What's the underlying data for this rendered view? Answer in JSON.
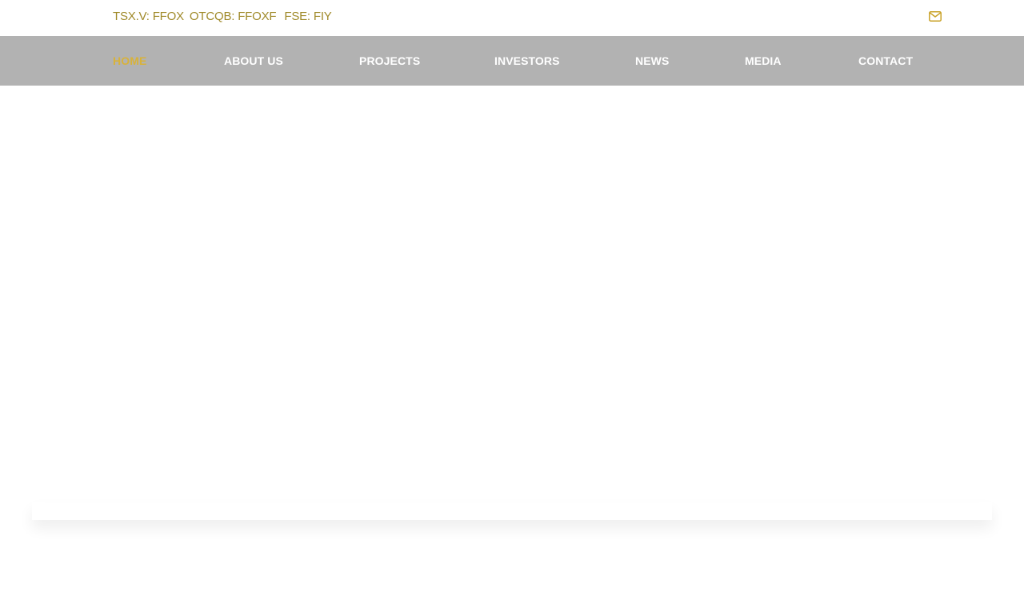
{
  "topbar": {
    "tickers": [
      "TSX.V: FFOX",
      "OTCQB: FFOXF",
      "FSE: FIY"
    ],
    "mail_icon": "envelope-icon",
    "accent_color": "#a08a2a"
  },
  "nav": {
    "items": [
      {
        "label": "HOME",
        "active": true
      },
      {
        "label": "ABOUT US",
        "active": false
      },
      {
        "label": "PROJECTS",
        "active": false
      },
      {
        "label": "INVESTORS",
        "active": false
      },
      {
        "label": "NEWS",
        "active": false
      },
      {
        "label": "MEDIA",
        "active": false
      },
      {
        "label": "CONTACT",
        "active": false
      }
    ],
    "background_color": "#b2b2b2",
    "active_color": "#d8b23a"
  }
}
